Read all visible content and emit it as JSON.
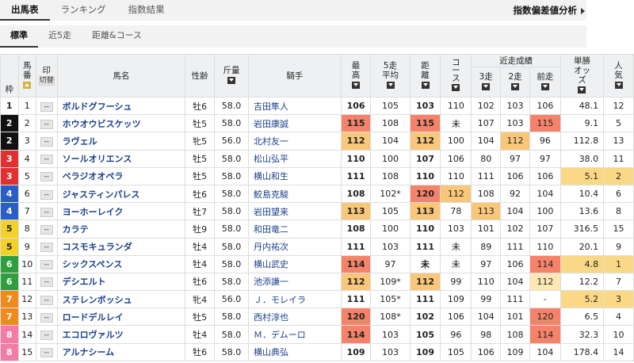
{
  "top_tabs": [
    "出馬表",
    "ランキング",
    "指数結果"
  ],
  "analysis_link": "指数偏差値分析",
  "sub_tabs": [
    "標準",
    "近5走",
    "距離&コース"
  ],
  "headers": {
    "waku": "枠",
    "umaban": "馬番",
    "mark": "印",
    "mark_btn": "切替",
    "name": "馬名",
    "sex_age": "性齢",
    "weight": "斤量",
    "jockey": "騎手",
    "best": "最高",
    "avg5": "5走平均",
    "dist": "距離",
    "course": "コース",
    "recent": "近走成績",
    "r3": "3走",
    "r2": "2走",
    "r1": "前走",
    "odds": "単勝オッズ",
    "pop": "人気"
  },
  "rows": [
    {
      "waku": "1",
      "w": 1,
      "num": "1",
      "mark": "--",
      "name": "ボルドグフーシュ",
      "sex": "牡6",
      "wt": "58.0",
      "jk": "吉田隼人",
      "best": "106",
      "avg": "105",
      "dist": "103",
      "course": "110",
      "r3": "102",
      "r2": "103",
      "r1": "106",
      "odds": "48.1",
      "pop": "12",
      "hl": {}
    },
    {
      "waku": "2",
      "w": 2,
      "num": "2",
      "mark": "--",
      "name": "ホウオウビスケッツ",
      "sex": "牡5",
      "wt": "58.0",
      "jk": "岩田康誠",
      "best": "115",
      "avg": "108",
      "dist": "115",
      "course": "未",
      "r3": "107",
      "r2": "103",
      "r1": "115",
      "odds": "9.1",
      "pop": "5",
      "hl": {
        "best": "h1",
        "dist": "h1",
        "r1": "h1"
      }
    },
    {
      "waku": "2",
      "w": 2,
      "num": "3",
      "mark": "--",
      "name": "ラヴェル",
      "sex": "牝5",
      "wt": "56.0",
      "jk": "北村友一",
      "best": "112",
      "avg": "104",
      "dist": "112",
      "course": "100",
      "r3": "104",
      "r2": "112",
      "r1": "96",
      "odds": "112.8",
      "pop": "13",
      "hl": {
        "best": "h2",
        "dist": "h2",
        "r2": "h2"
      }
    },
    {
      "waku": "3",
      "w": 3,
      "num": "4",
      "mark": "--",
      "name": "ソールオリエンス",
      "sex": "牡5",
      "wt": "58.0",
      "jk": "松山弘平",
      "best": "110",
      "avg": "100",
      "dist": "107",
      "course": "106",
      "r3": "80",
      "r2": "97",
      "r1": "",
      "odds": "38.0",
      "pop": "11",
      "hl": {},
      "r1v": "97"
    },
    {
      "waku": "3",
      "w": 3,
      "num": "5",
      "mark": "--",
      "name": "ベラジオオペラ",
      "sex": "牡5",
      "wt": "58.0",
      "jk": "横山和生",
      "best": "111",
      "avg": "108",
      "dist": "110",
      "course": "110",
      "r3": "111",
      "r2": "106",
      "r1": "106",
      "odds": "5.1",
      "pop": "2",
      "hl": {
        "odds": "o1",
        "pop": "o1"
      }
    },
    {
      "waku": "4",
      "w": 4,
      "num": "6",
      "mark": "--",
      "name": "ジャスティンパレス",
      "sex": "牡6",
      "wt": "58.0",
      "jk": "鮫島克駿",
      "best": "108",
      "avg": "102*",
      "dist": "120",
      "course": "112",
      "r3": "108",
      "r2": "92",
      "r1": "104",
      "odds": "10.4",
      "pop": "6",
      "hl": {
        "dist": "h1",
        "course": "h2"
      }
    },
    {
      "waku": "4",
      "w": 4,
      "num": "7",
      "mark": "--",
      "name": "ヨーホーレイク",
      "sex": "牡7",
      "wt": "58.0",
      "jk": "岩田望来",
      "best": "113",
      "avg": "105",
      "dist": "113",
      "course": "78",
      "r3": "113",
      "r2": "104",
      "r1": "100",
      "odds": "13.6",
      "pop": "8",
      "hl": {
        "best": "h2",
        "dist": "h2",
        "r3": "h2"
      }
    },
    {
      "waku": "5",
      "w": 5,
      "num": "8",
      "mark": "--",
      "name": "カラテ",
      "sex": "牡9",
      "wt": "58.0",
      "jk": "和田竜二",
      "best": "108",
      "avg": "100",
      "dist": "110",
      "course": "103",
      "r3": "101",
      "r2": "102",
      "r1": "107",
      "odds": "316.5",
      "pop": "15",
      "hl": {}
    },
    {
      "waku": "5",
      "w": 5,
      "num": "9",
      "mark": "--",
      "name": "コスモキュランダ",
      "sex": "牡4",
      "wt": "58.0",
      "jk": "丹内祐次",
      "best": "111",
      "avg": "103",
      "dist": "111",
      "course": "未",
      "r3": "89",
      "r2": "111",
      "r1": "110",
      "odds": "20.1",
      "pop": "9",
      "hl": {}
    },
    {
      "waku": "6",
      "w": 6,
      "num": "10",
      "mark": "--",
      "name": "シックスペンス",
      "sex": "牡4",
      "wt": "58.0",
      "jk": "横山武史",
      "best": "114",
      "avg": "97",
      "dist": "未",
      "course": "未",
      "r3": "97",
      "r2": "106",
      "r1": "114",
      "odds": "4.8",
      "pop": "1",
      "hl": {
        "best": "h1",
        "r1": "h1",
        "odds": "o1",
        "pop": "o1"
      }
    },
    {
      "waku": "6",
      "w": 6,
      "num": "11",
      "mark": "--",
      "name": "デシエルト",
      "sex": "牡6",
      "wt": "58.0",
      "jk": "池添謙一",
      "best": "112",
      "avg": "109*",
      "dist": "112",
      "course": "99",
      "r3": "110",
      "r2": "104",
      "r1": "112",
      "odds": "12.2",
      "pop": "7",
      "hl": {
        "best": "h2",
        "dist": "h2",
        "r1": "h3"
      }
    },
    {
      "waku": "7",
      "w": 7,
      "num": "12",
      "mark": "--",
      "name": "ステレンボッシュ",
      "sex": "牝4",
      "wt": "56.0",
      "jk": "Ｊ．モレイラ",
      "best": "111",
      "avg": "105*",
      "dist": "111",
      "course": "109",
      "r3": "99",
      "r2": "111",
      "r1": "-",
      "odds": "5.2",
      "pop": "3",
      "hl": {
        "odds": "o1",
        "pop": "o1"
      }
    },
    {
      "waku": "7",
      "w": 7,
      "num": "13",
      "mark": "--",
      "name": "ロードデルレイ",
      "sex": "牡5",
      "wt": "58.0",
      "jk": "西村淳也",
      "best": "120",
      "avg": "108*",
      "dist": "102",
      "course": "106",
      "r3": "104",
      "r2": "101",
      "r1": "120",
      "odds": "6.5",
      "pop": "4",
      "hl": {
        "best": "h1",
        "r1": "h1"
      }
    },
    {
      "waku": "8",
      "w": 8,
      "num": "14",
      "mark": "--",
      "name": "エコロヴァルツ",
      "sex": "牡4",
      "wt": "58.0",
      "jk": "Ｍ．デムーロ",
      "best": "114",
      "avg": "103",
      "dist": "105",
      "course": "96",
      "r3": "98",
      "r2": "108",
      "r1": "114",
      "odds": "32.3",
      "pop": "10",
      "hl": {
        "best": "h1",
        "r1": "h1"
      }
    },
    {
      "waku": "8",
      "w": 8,
      "num": "15",
      "mark": "--",
      "name": "アルナシーム",
      "sex": "牡6",
      "wt": "58.0",
      "jk": "横山典弘",
      "best": "109",
      "avg": "103",
      "dist": "109",
      "course": "105",
      "r3": "106",
      "r2": "109",
      "r1": "104",
      "odds": "178.4",
      "pop": "14",
      "hl": {}
    }
  ]
}
